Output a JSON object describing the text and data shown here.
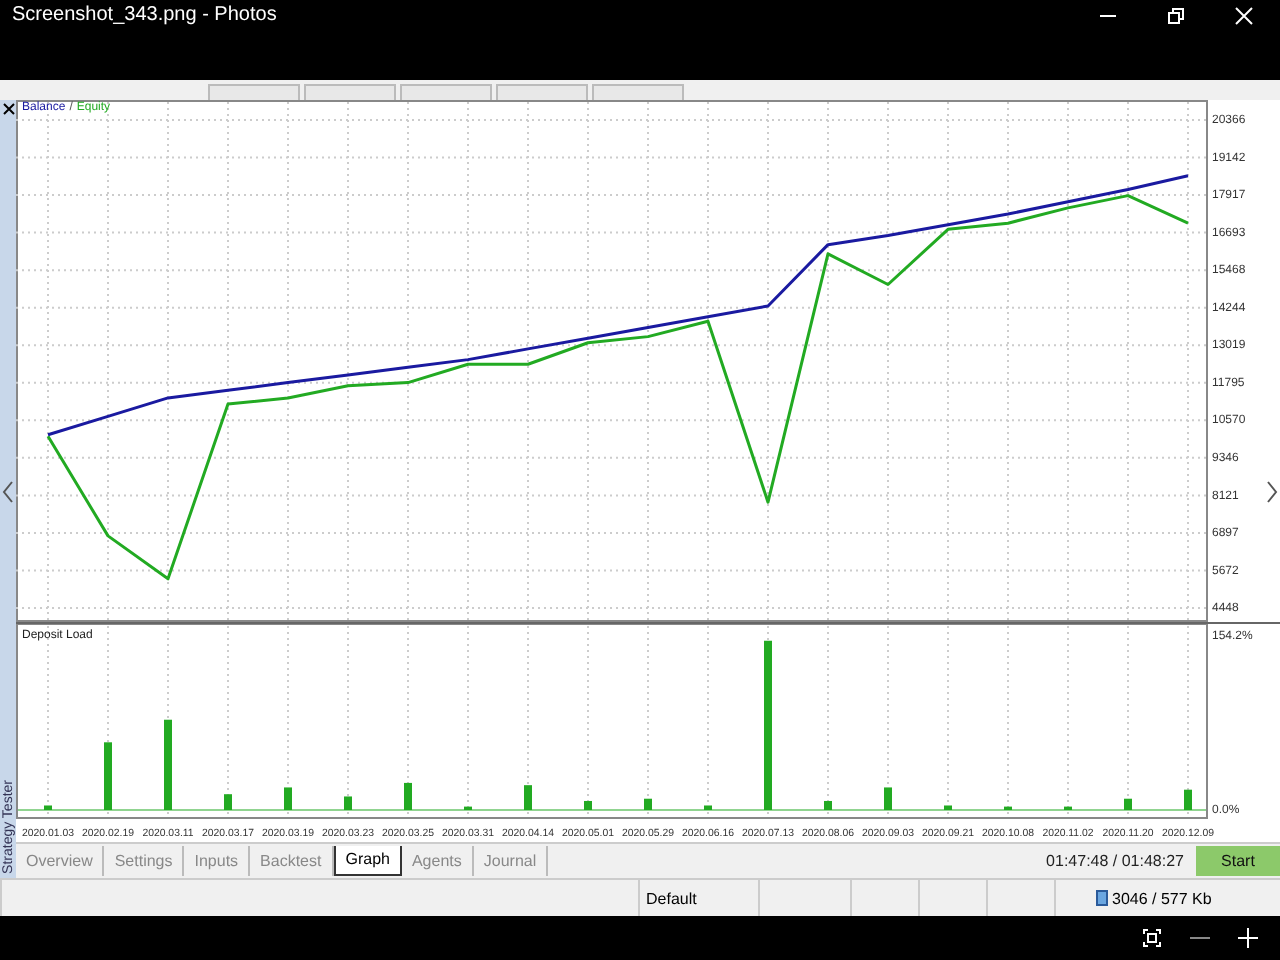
{
  "window": {
    "title": "Screenshot_343.png - Photos"
  },
  "balance_chart": {
    "separator": "/",
    "chart_data": {
      "type": "line",
      "grid": true,
      "series": [
        {
          "name": "Balance",
          "color": "#1a1aa0",
          "values": [
            10100,
            10700,
            11300,
            11550,
            11800,
            12050,
            12300,
            12550,
            12900,
            13250,
            13600,
            13950,
            14300,
            16300,
            16600,
            16950,
            17300,
            17700,
            18100,
            18550
          ]
        },
        {
          "name": "Equity",
          "color": "#22aa22",
          "values": [
            10050,
            6800,
            5400,
            11100,
            11300,
            11700,
            11800,
            12400,
            12400,
            13100,
            13300,
            13800,
            7900,
            16000,
            15000,
            16800,
            17000,
            17500,
            17900,
            17000
          ]
        }
      ],
      "ylim": [
        4448,
        20366
      ],
      "yticks": [
        20366,
        19142,
        17917,
        16693,
        15468,
        14244,
        13019,
        11795,
        10570,
        9346,
        8121,
        6897,
        5672,
        4448
      ]
    }
  },
  "load_chart": {
    "title": "Deposit Load",
    "chart_data": {
      "type": "bar",
      "grid": true,
      "categories": [
        "2020.01.03",
        "2020.02.19",
        "2020.03.11",
        "2020.03.17",
        "2020.03.19",
        "2020.03.23",
        "2020.03.25",
        "2020.03.31",
        "2020.04.14",
        "2020.05.01",
        "2020.05.29",
        "2020.06.16",
        "2020.07.13",
        "2020.08.06",
        "2020.09.03",
        "2020.09.21",
        "2020.10.08",
        "2020.11.02",
        "2020.11.20",
        "2020.12.09"
      ],
      "values": [
        4,
        60,
        80,
        14,
        20,
        12,
        24,
        3,
        22,
        8,
        10,
        4,
        150,
        8,
        20,
        4,
        3,
        3,
        10,
        18
      ],
      "ylim": [
        0,
        154.2
      ],
      "yticks": [
        {
          "value": 0,
          "label": "0.0%"
        },
        {
          "value": 154.2,
          "label": "154.2%"
        }
      ]
    }
  },
  "side_label": "Strategy Tester",
  "tabs": [
    {
      "label": "Overview",
      "selected": false
    },
    {
      "label": "Settings",
      "selected": false
    },
    {
      "label": "Inputs",
      "selected": false
    },
    {
      "label": "Backtest",
      "selected": false
    },
    {
      "label": "Graph",
      "selected": true
    },
    {
      "label": "Agents",
      "selected": false
    },
    {
      "label": "Journal",
      "selected": false
    }
  ],
  "timer": "01:47:48 / 01:48:27",
  "start_button": "Start",
  "status_bar": {
    "profile": "Default",
    "traffic": "3046 / 577 Kb"
  }
}
